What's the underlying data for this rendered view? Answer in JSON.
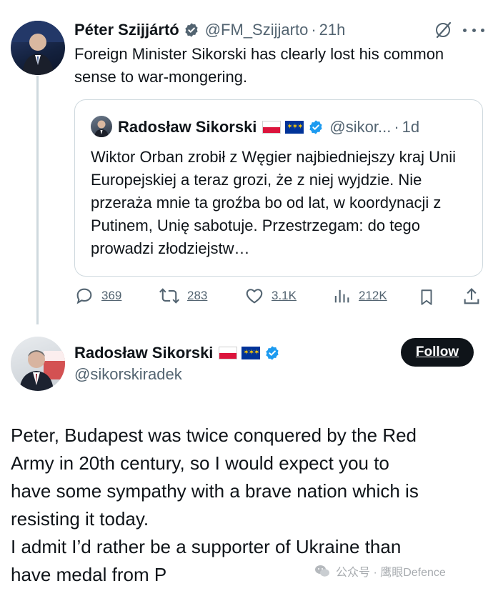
{
  "tweet": {
    "author_name": "Péter Szijjártó",
    "handle": "@FM_Szijjarto",
    "separator": "·",
    "time": "21h",
    "text": "Foreign Minister Sikorski has clearly lost his common sense to war-mongering.",
    "more_icon": "more-icon",
    "grok_icon": "grok-icon",
    "quote": {
      "author_name": "Radosław Sikorski",
      "handle": "@sikor...",
      "separator": "·",
      "time": "1d",
      "text": "Wiktor Orban zrobił z Węgier najbiedniejszy kraj Unii Europejskiej a teraz grozi, że z niej wyjdzie. Nie przeraża mnie ta groźba bo od lat, w koordynacji z Putinem, Unię sabotuje. Przestrzegam: do tego prowadzi złodziejstw…"
    },
    "actions": {
      "replies": "369",
      "reposts": "283",
      "likes": "3.1K",
      "views": "212K"
    }
  },
  "reply": {
    "author_name": "Radosław Sikorski",
    "handle": "@sikorskiradek",
    "follow_label": "Follow",
    "text_lines": [
      "Peter, Budapest was twice conquered by the Red",
      "Army in 20th century, so I would expect you to",
      "have some sympathy with a brave nation which is",
      "resisting it today.",
      "I admit I’d rather be a supporter of Ukraine than",
      "have medal from P"
    ]
  },
  "watermark": {
    "text": "公众号 · 鹰眼Defence"
  },
  "colors": {
    "text": "#0f1419",
    "muted": "#536471",
    "border": "#cfd9de",
    "verified": "#1d9bf0",
    "follow_bg": "#0f1419"
  }
}
